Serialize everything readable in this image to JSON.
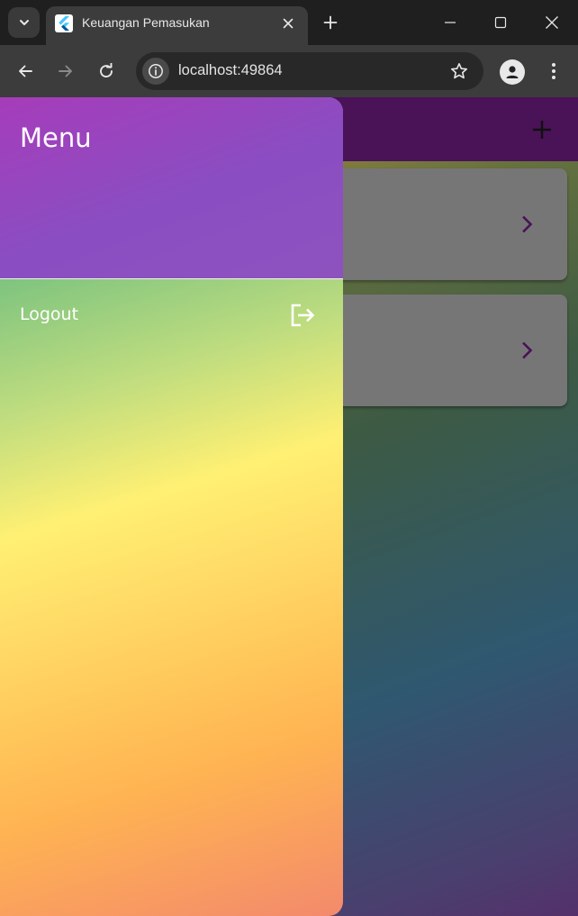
{
  "browser": {
    "tab": {
      "title": "Keuangan Pemasukan",
      "favicon": "flutter-logo-icon"
    },
    "address_bar": {
      "url": "localhost:49864"
    },
    "icons": {
      "tab_search": "chevron-down-icon",
      "tab_close": "close-icon",
      "new_tab": "plus-icon",
      "minimize": "minimize-icon",
      "maximize": "maximize-icon",
      "close_window": "close-icon",
      "back": "arrow-left-icon",
      "forward": "arrow-right-icon",
      "reload": "reload-icon",
      "site_info": "info-icon",
      "bookmark": "star-icon",
      "profile": "person-icon",
      "menu": "more-vert-icon"
    }
  },
  "app": {
    "appbar": {
      "action_icon": "plus-icon"
    },
    "cards": [
      {
        "icon": "chevron-right-icon"
      },
      {
        "icon": "chevron-right-icon"
      }
    ],
    "drawer": {
      "title": "Menu",
      "items": [
        {
          "label": "Logout",
          "icon": "logout-icon"
        }
      ]
    },
    "colors": {
      "appbar": "#4a1257",
      "card": "#767676",
      "chevron": "#4a1257",
      "drawer_header_start": "#a63cba",
      "drawer_header_end": "#8e52bf",
      "drawer_gradient": [
        "#6bb4f2",
        "#7fc47f",
        "#fff073",
        "#ffb352",
        "#f38a6c"
      ]
    }
  }
}
